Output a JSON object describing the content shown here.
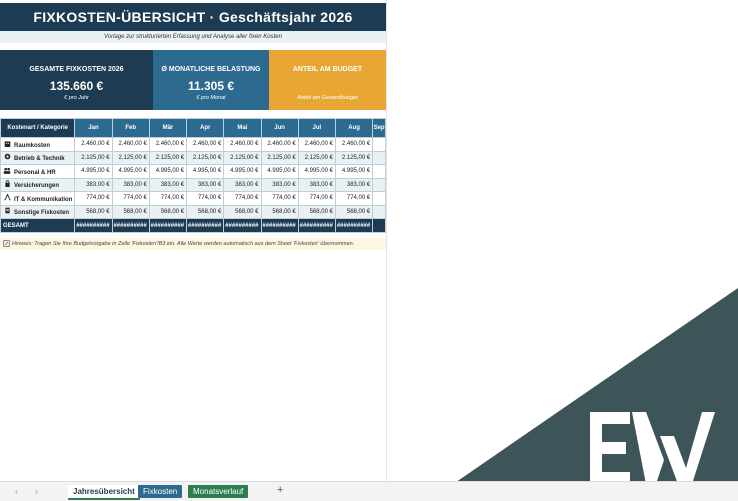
{
  "header": {
    "title": "FIXKOSTEN-ÜBERSICHT  ·  Geschäftsjahr 2026",
    "subtitle": "Vorlage zur strukturierten Erfassung und Analyse aller fixen Kosten"
  },
  "cards": [
    {
      "label": "GESAMTE FIXKOSTEN 2026",
      "value": "135.660 €",
      "sub": "€ pro Jahr"
    },
    {
      "label": "Ø MONATLICHE BELASTUNG",
      "value": "11.305 €",
      "sub": "€ pro Monat"
    },
    {
      "label": "ANTEIL AM BUDGET",
      "value": "",
      "sub": "Anteil am Gesamtbudget"
    }
  ],
  "table": {
    "header_category": "Kostenart / Kategorie",
    "months": [
      "Jan",
      "Feb",
      "Mär",
      "Apr",
      "Mai",
      "Jun",
      "Jul",
      "Aug",
      "Sep"
    ],
    "rows": [
      {
        "icon": "building-icon",
        "label": "Raumkosten",
        "value": "2.460,00 €"
      },
      {
        "icon": "gear-icon",
        "label": "Betrieb & Technik",
        "value": "2.125,00 €"
      },
      {
        "icon": "people-icon",
        "label": "Personal & HR",
        "value": "4.995,00 €"
      },
      {
        "icon": "lock-icon",
        "label": "Versicherungen",
        "value": "383,00 €"
      },
      {
        "icon": "network-icon",
        "label": "IT & Kommunikation",
        "value": "774,00 €"
      },
      {
        "icon": "document-icon",
        "label": "Sonstige Fixkosten",
        "value": "568,00 €"
      }
    ],
    "total_label": "GESAMT",
    "total_value": "##########"
  },
  "hint": "Hinweis: Tragen Sie Ihre Budgetvorgabe in Zelle 'Fixkosten'!B3 ein. Alle Werte werden automatisch aus dem Sheet 'Fixkosten' übernommen.",
  "tabs": {
    "prev": "‹",
    "next": "›",
    "items": [
      "Jahresübersicht",
      "Fixkosten",
      "Monatsverlauf"
    ],
    "add": "+"
  },
  "colors": {
    "navy": "#1d3b52",
    "blue": "#2c6a8f",
    "orange": "#e8a735",
    "green": "#2e7d4f",
    "slate": "#3d5459"
  }
}
